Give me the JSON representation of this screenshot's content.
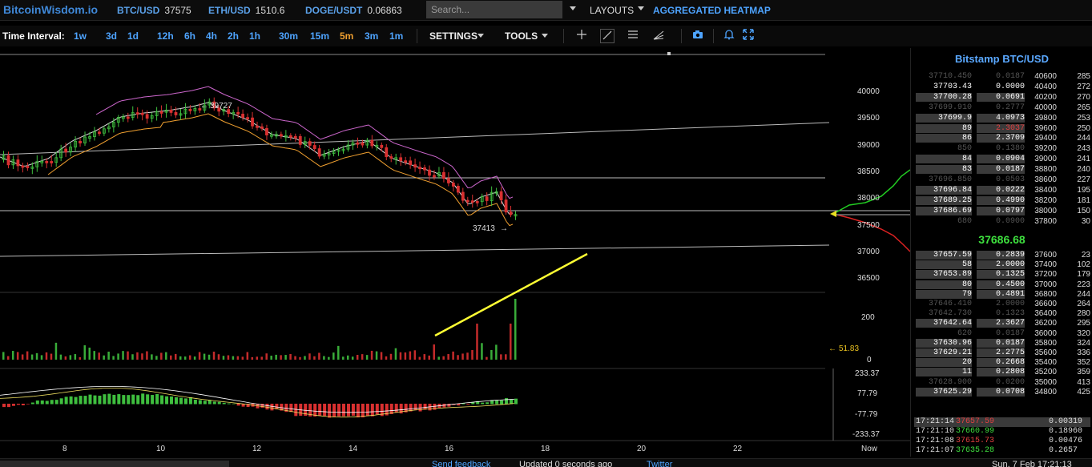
{
  "topbar": {
    "logo": "BitcoinWisdom.io",
    "tickers": [
      {
        "symbol": "BTC/USD",
        "price": "37575"
      },
      {
        "symbol": "ETH/USD",
        "price": "1510.6"
      },
      {
        "symbol": "DOGE/USDT",
        "price": "0.06863"
      }
    ],
    "search_placeholder": "Search...",
    "layouts_label": "LAYOUTS",
    "heatmap_label": "AGGREGATED HEATMAP"
  },
  "toolbar": {
    "time_interval_label": "Time Interval:",
    "intervals": [
      "1w",
      "3d",
      "1d",
      "12h",
      "6h",
      "4h",
      "2h",
      "1h",
      "30m",
      "15m",
      "5m",
      "3m",
      "1m"
    ],
    "active_interval": "5m",
    "settings_label": "SETTINGS",
    "tools_label": "TOOLS",
    "icons": [
      "crosshair-icon",
      "line-draw-icon",
      "horizontal-lines-icon",
      "fan-icon",
      "camera-icon",
      "bell-icon",
      "fullscreen-icon"
    ]
  },
  "chart": {
    "price_axis": [
      "40000",
      "39500",
      "39000",
      "38500",
      "38000",
      "37500",
      "37000",
      "36500"
    ],
    "volume_axis": [
      "200",
      "0"
    ],
    "macd_axis": [
      "233.37",
      "77.79",
      "-77.79",
      "-233.37"
    ],
    "x_axis": [
      "8",
      "10",
      "12",
      "14",
      "16",
      "18",
      "20",
      "22",
      "Now"
    ],
    "high_label": "39727",
    "low_label": "37413",
    "volume_marker": "51.83",
    "colors": {
      "up": "#3fbf3f",
      "down": "#d93030",
      "trend": "#ffff33",
      "ma_upper": "#cc66cc",
      "ma_mid": "#dddddd",
      "ma_lower": "#f0a030"
    }
  },
  "orderbook": {
    "title": "Bitstamp BTC/USD",
    "asks": [
      {
        "price": "37710.450",
        "amount": "0.0187",
        "level": "40600",
        "count": "285",
        "style": "dim"
      },
      {
        "price": "37703.43",
        "amount": "0.0000",
        "level": "40400",
        "count": "272",
        "style": "bright"
      },
      {
        "price": "37700.28",
        "amount": "0.0691",
        "level": "40200",
        "count": "270",
        "style": "hl"
      },
      {
        "price": "37699.910",
        "amount": "0.2777",
        "level": "40000",
        "count": "265",
        "style": "dim"
      },
      {
        "price": "37699.9",
        "amount": "4.0973",
        "level": "39800",
        "count": "253",
        "style": "hl"
      },
      {
        "price": "89",
        "amount": "2.3037",
        "level": "39600",
        "count": "250",
        "style": "hlred"
      },
      {
        "price": "86",
        "amount": "2.3709",
        "level": "39400",
        "count": "244",
        "style": "hl"
      },
      {
        "price": "850",
        "amount": "0.1380",
        "level": "39200",
        "count": "243",
        "style": "dim"
      },
      {
        "price": "84",
        "amount": "0.0904",
        "level": "39000",
        "count": "241",
        "style": "hl"
      },
      {
        "price": "83",
        "amount": "0.0187",
        "level": "38800",
        "count": "240",
        "style": "hl"
      },
      {
        "price": "37696.850",
        "amount": "0.0503",
        "level": "38600",
        "count": "227",
        "style": "dim"
      },
      {
        "price": "37696.84",
        "amount": "0.0222",
        "level": "38400",
        "count": "195",
        "style": "hl"
      },
      {
        "price": "37689.25",
        "amount": "0.4990",
        "level": "38200",
        "count": "181",
        "style": "hl"
      },
      {
        "price": "37686.69",
        "amount": "0.0797",
        "level": "38000",
        "count": "150",
        "style": "hl"
      },
      {
        "price": "680",
        "amount": "0.0900",
        "level": "37800",
        "count": "30",
        "style": "dim"
      }
    ],
    "last_price": "37686.68",
    "bids": [
      {
        "price": "37657.59",
        "amount": "0.2839",
        "level": "37600",
        "count": "23",
        "style": "hl"
      },
      {
        "price": "58",
        "amount": "2.0000",
        "level": "37400",
        "count": "102",
        "style": "hl"
      },
      {
        "price": "37653.89",
        "amount": "0.1325",
        "level": "37200",
        "count": "179",
        "style": "hl"
      },
      {
        "price": "80",
        "amount": "0.4500",
        "level": "37000",
        "count": "223",
        "style": "hl"
      },
      {
        "price": "79",
        "amount": "0.4891",
        "level": "36800",
        "count": "244",
        "style": "hl"
      },
      {
        "price": "37646.410",
        "amount": "2.0000",
        "level": "36600",
        "count": "264",
        "style": "dim"
      },
      {
        "price": "37642.730",
        "amount": "0.1323",
        "level": "36400",
        "count": "280",
        "style": "dim"
      },
      {
        "price": "37642.64",
        "amount": "2.3627",
        "level": "36200",
        "count": "295",
        "style": "hl"
      },
      {
        "price": "620",
        "amount": "0.0187",
        "level": "36000",
        "count": "320",
        "style": "dim"
      },
      {
        "price": "37630.96",
        "amount": "0.0187",
        "level": "35800",
        "count": "324",
        "style": "hl"
      },
      {
        "price": "37629.21",
        "amount": "2.2775",
        "level": "35600",
        "count": "336",
        "style": "hl"
      },
      {
        "price": "20",
        "amount": "0.2668",
        "level": "35400",
        "count": "352",
        "style": "hl"
      },
      {
        "price": "11",
        "amount": "0.2808",
        "level": "35200",
        "count": "359",
        "style": "hl"
      },
      {
        "price": "37628.900",
        "amount": "0.0200",
        "level": "35000",
        "count": "413",
        "style": "dim"
      },
      {
        "price": "37625.29",
        "amount": "0.0708",
        "level": "34800",
        "count": "425",
        "style": "hl"
      }
    ],
    "trades": [
      {
        "time": "17:21:14",
        "price": "37657.59",
        "amount": "0.00319",
        "dir": "down"
      },
      {
        "time": "17:21:10",
        "price": "37660.99",
        "amount": "0.18960",
        "dir": "up"
      },
      {
        "time": "17:21:08",
        "price": "37615.73",
        "amount": "0.00476",
        "dir": "down"
      },
      {
        "time": "17:21:07",
        "price": "37635.28",
        "amount": "0.2657",
        "dir": "up"
      }
    ]
  },
  "footer": {
    "feedback": "Send feedback",
    "updated": "Updated 0 seconds ago",
    "twitter": "Twitter",
    "datetime": "Sun, 7 Feb 17:21:13"
  }
}
